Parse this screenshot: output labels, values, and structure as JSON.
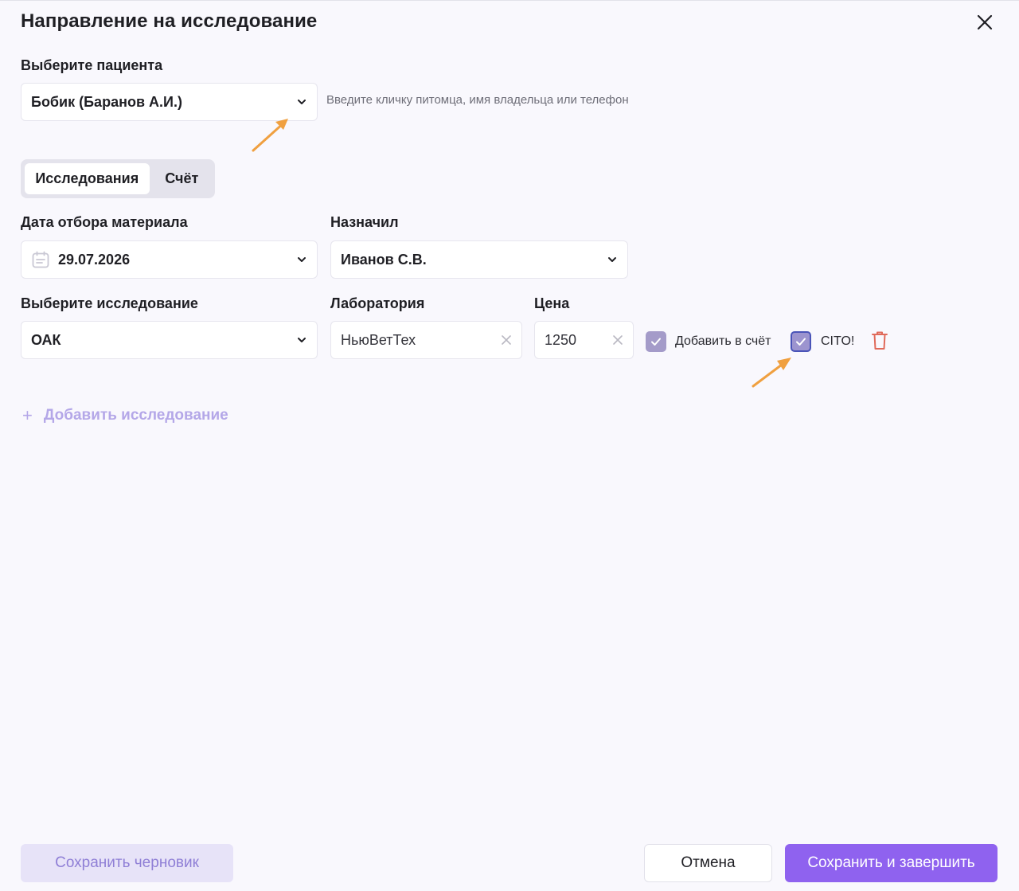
{
  "dialog": {
    "title": "Направление на исследование"
  },
  "patient": {
    "label": "Выберите пациента",
    "value": "Бобик (Баранов А.И.)",
    "hint": "Введите кличку питомца, имя владельца или телефон"
  },
  "tabs": [
    {
      "label": "Исследования",
      "active": true
    },
    {
      "label": "Счёт",
      "active": false
    }
  ],
  "sample_date": {
    "label": "Дата отбора материала",
    "value": "29.07.2026"
  },
  "assigned_by": {
    "label": "Назначил",
    "value": "Иванов С.В."
  },
  "study": {
    "label": "Выберите исследование",
    "value": "ОАК"
  },
  "laboratory": {
    "label": "Лаборатория",
    "value": "НьюВетТех"
  },
  "price": {
    "label": "Цена",
    "value": "1250"
  },
  "add_to_invoice": {
    "label": "Добавить в счёт",
    "checked": true
  },
  "cito": {
    "label": "CITO!",
    "checked": true
  },
  "add_study": {
    "label": "Добавить исследование"
  },
  "footer": {
    "draft_label": "Сохранить черновик",
    "cancel_label": "Отмена",
    "save_label": "Сохранить и завершить"
  },
  "colors": {
    "accent": "#8f62ef",
    "checkbox": "#a49bc9",
    "annotation_arrow": "#f0a040",
    "delete": "#e06a5a"
  },
  "icons": {
    "close": "close-icon",
    "chevron": "chevron-down-icon",
    "calendar": "calendar-icon",
    "clear": "clear-icon",
    "check": "check-icon",
    "delete": "trash-icon",
    "add": "plus-icon"
  }
}
